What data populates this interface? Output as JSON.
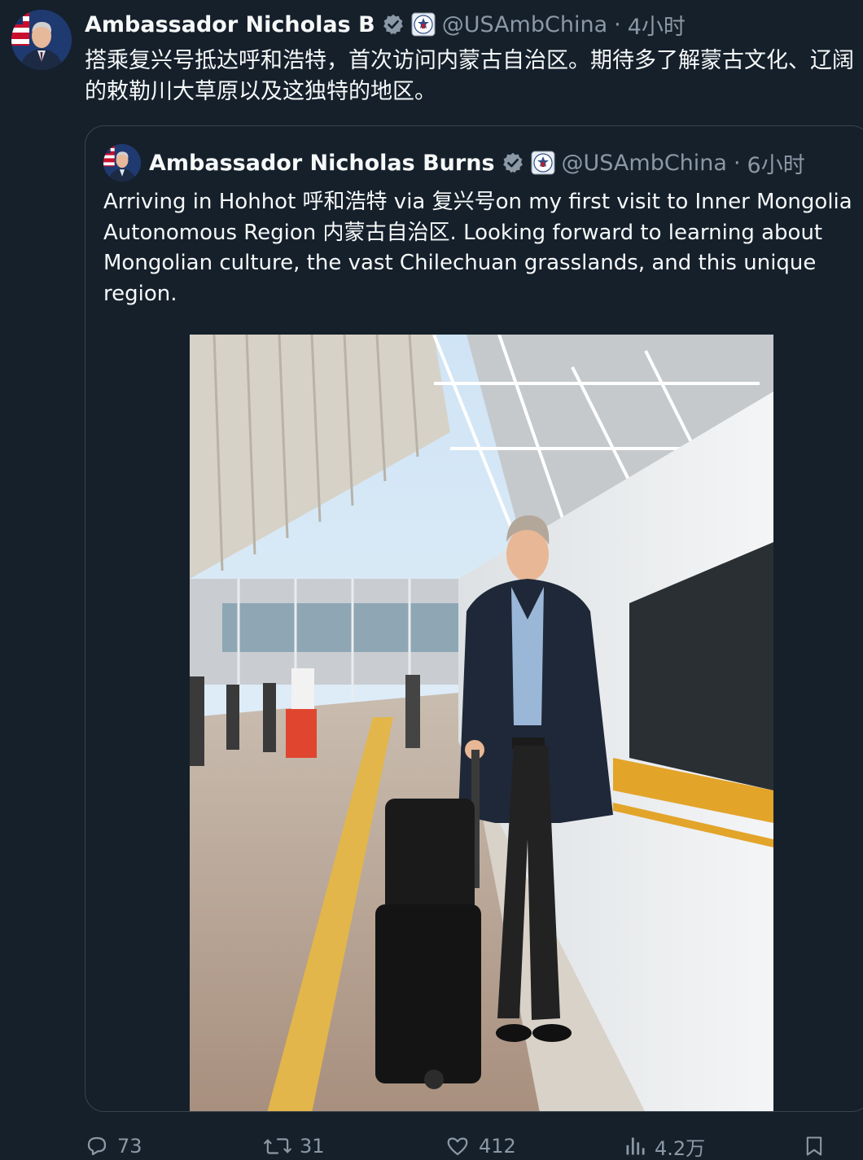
{
  "post": {
    "author_name": "Ambassador Nicholas B",
    "handle": "@USAmbChina",
    "separator": "·",
    "time": "4小时",
    "text": "搭乘复兴号抵达呼和浩特，首次访问内蒙古自治区。期待多了解蒙古文化、辽阔的敕勒川大草原以及这独特的地区。"
  },
  "quote": {
    "author_name": "Ambassador Nicholas Burns",
    "handle": "@USAmbChina",
    "separator": "·",
    "time": "6小时",
    "text": "Arriving in Hohhot 呼和浩特 via 复兴号on my first visit to Inner Mongolia Autonomous Region 内蒙古自治区. Looking forward to learning about Mongolian culture, the vast Chilechuan grasslands, and this unique region."
  },
  "actions": {
    "replies": "73",
    "reposts": "31",
    "likes": "412",
    "views": "4.2万"
  },
  "colors": {
    "background": "#15202b",
    "text_primary": "#f7f9f9",
    "text_secondary": "#8b98a5",
    "border": "#38444d",
    "verified_badge": "#8b98a5"
  },
  "icons": {
    "verified": "verified-badge-icon",
    "affiliate": "us-embassy-seal-icon",
    "reply": "reply-icon",
    "repost": "repost-icon",
    "like": "like-icon",
    "views": "views-icon",
    "bookmark": "bookmark-icon"
  }
}
